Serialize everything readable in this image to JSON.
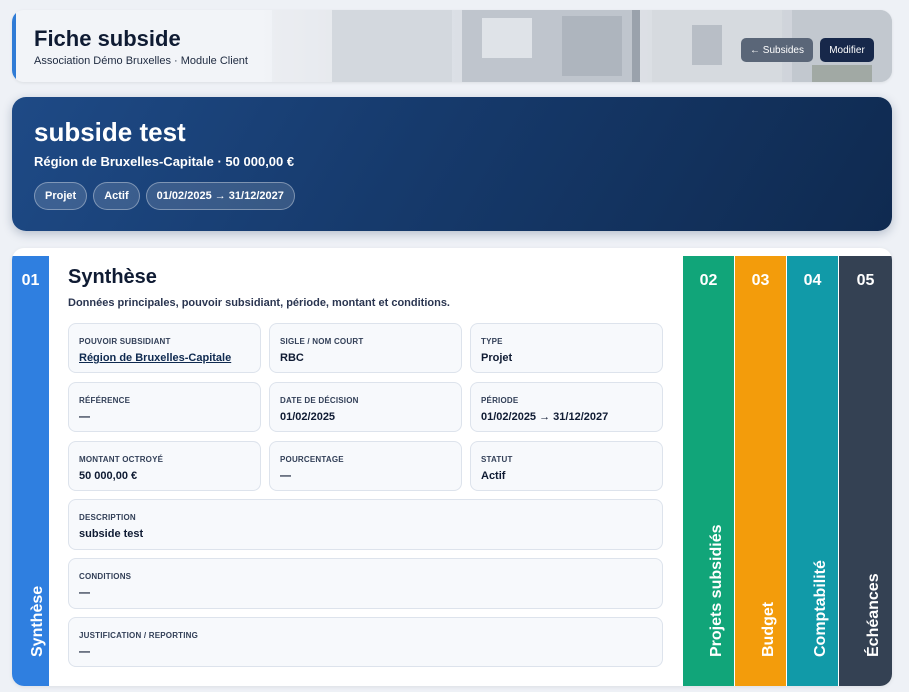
{
  "header": {
    "title": "Fiche subside",
    "subtitle": "Association Démo Bruxelles · Module Client",
    "back_label": "← Subsides",
    "edit_label": "Modifier"
  },
  "hero": {
    "title": "subside test",
    "subtitle": "Région de Bruxelles-Capitale · 50 000,00 €",
    "chips": [
      "Projet",
      "Actif",
      "01/02/2025 → 31/12/2027"
    ]
  },
  "active_section": {
    "number": "01",
    "label": "Synthèse",
    "title": "Synthèse",
    "description": "Données principales, pouvoir subsidiant, période, montant et conditions.",
    "fields": {
      "pouvoir": {
        "label": "Pouvoir subsidiant",
        "value": "Région de Bruxelles-Capitale"
      },
      "sigle": {
        "label": "Sigle / nom court",
        "value": "RBC"
      },
      "type": {
        "label": "Type",
        "value": "Projet"
      },
      "reference": {
        "label": "Référence",
        "value": "—"
      },
      "date_decision": {
        "label": "Date de décision",
        "value": "01/02/2025"
      },
      "periode": {
        "label": "Période",
        "value": "01/02/2025 → 31/12/2027"
      },
      "montant": {
        "label": "Montant octroyé",
        "value": "50 000,00 €"
      },
      "pourcentage": {
        "label": "Pourcentage",
        "value": "—"
      },
      "statut": {
        "label": "Statut",
        "value": "Actif"
      },
      "description": {
        "label": "Description",
        "value": "subside test"
      },
      "conditions": {
        "label": "Conditions",
        "value": "—"
      },
      "justification": {
        "label": "Justification / reporting",
        "value": "—"
      }
    }
  },
  "tabs": [
    {
      "number": "02",
      "label": "Projets subsidiés",
      "color": "#11a579"
    },
    {
      "number": "03",
      "label": "Budget",
      "color": "#f39c0b"
    },
    {
      "number": "04",
      "label": "Comptabilité",
      "color": "#119aa8"
    },
    {
      "number": "05",
      "label": "Échéances",
      "color": "#344153"
    }
  ],
  "colors": {
    "accent": "#2f7fe0",
    "hero": "#163a6c"
  }
}
